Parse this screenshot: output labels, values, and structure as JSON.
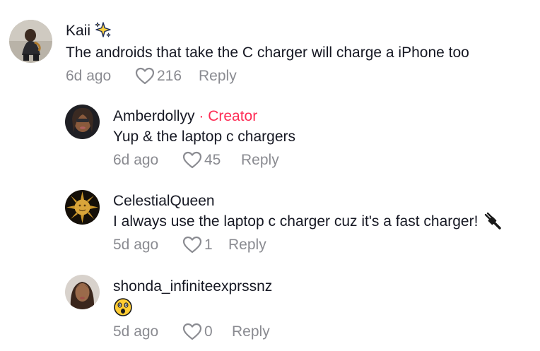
{
  "comments": [
    {
      "username": "Kaii",
      "text": "The androids that take the C charger will charge a iPhone too",
      "time": "6d ago",
      "likes": "216",
      "reply_label": "Reply",
      "avatar_icon": "person-photo",
      "badge_icon": "sparkles-icon"
    },
    {
      "username": "Amberdollyy",
      "creator_label": " · Creator",
      "text": "Yup & the laptop c chargers",
      "time": "6d ago",
      "likes": "45",
      "reply_label": "Reply",
      "avatar_icon": "person-photo"
    },
    {
      "username": "CelestialQueen",
      "text": "I always use the laptop c charger cuz it's a fast charger!",
      "time": "5d ago",
      "likes": "1",
      "reply_label": "Reply",
      "avatar_icon": "sun-photo",
      "trailing_icon": "electric-plug-emoji"
    },
    {
      "username": "shonda_infiniteexprssnz",
      "text": "",
      "time": "5d ago",
      "likes": "0",
      "reply_label": "Reply",
      "avatar_icon": "person-photo",
      "trailing_icon": "astonished-face-emoji"
    }
  ],
  "colors": {
    "text": "#161823",
    "secondary": "#8a8b91",
    "creator": "#fe2c55",
    "background": "#ffffff"
  }
}
